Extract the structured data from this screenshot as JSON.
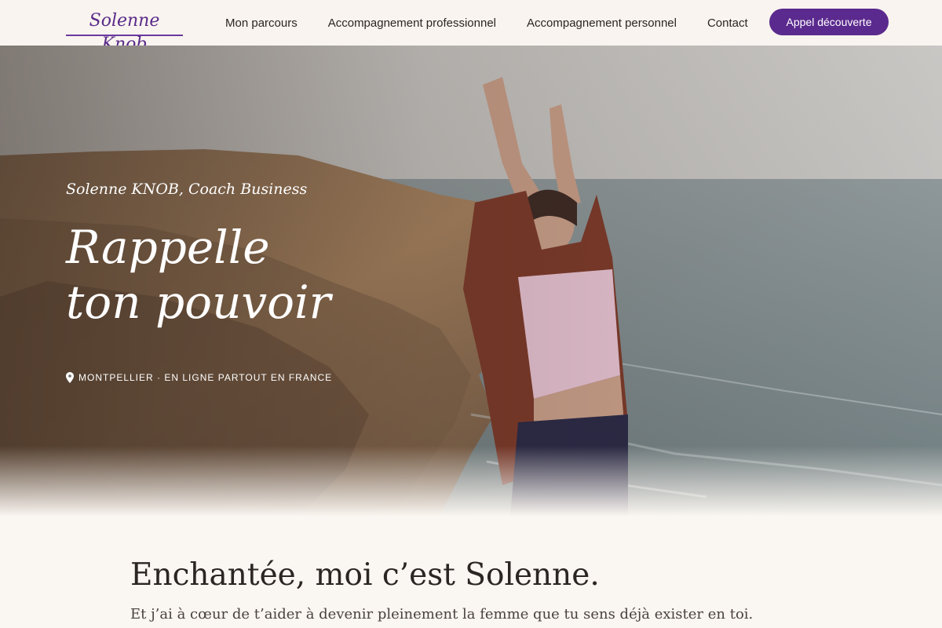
{
  "header": {
    "logo": "Solenne Knob",
    "nav": [
      {
        "label": "Mon parcours"
      },
      {
        "label": "Accompagnement professionnel"
      },
      {
        "label": "Accompagnement personnel"
      },
      {
        "label": "Contact"
      }
    ],
    "cta_label": "Appel découverte"
  },
  "hero": {
    "subtitle": "Solenne KNOB, Coach Business",
    "title_line1": "Rappelle",
    "title_line2": "ton pouvoir",
    "location": "MONTPELLIER · EN LIGNE PARTOUT EN FRANCE",
    "location_icon": "map-pin-icon",
    "image": "photo-woman-arms-raised-on-seaside-cliff"
  },
  "intro": {
    "title": "Enchantée, moi c’est Solenne.",
    "text": "Et j’ai à cœur de t’aider à devenir pleinement la femme que tu sens déjà exister en toi."
  },
  "colors": {
    "accent": "#5b2a8e",
    "background": "#faf6f1",
    "text": "#2b2523"
  }
}
